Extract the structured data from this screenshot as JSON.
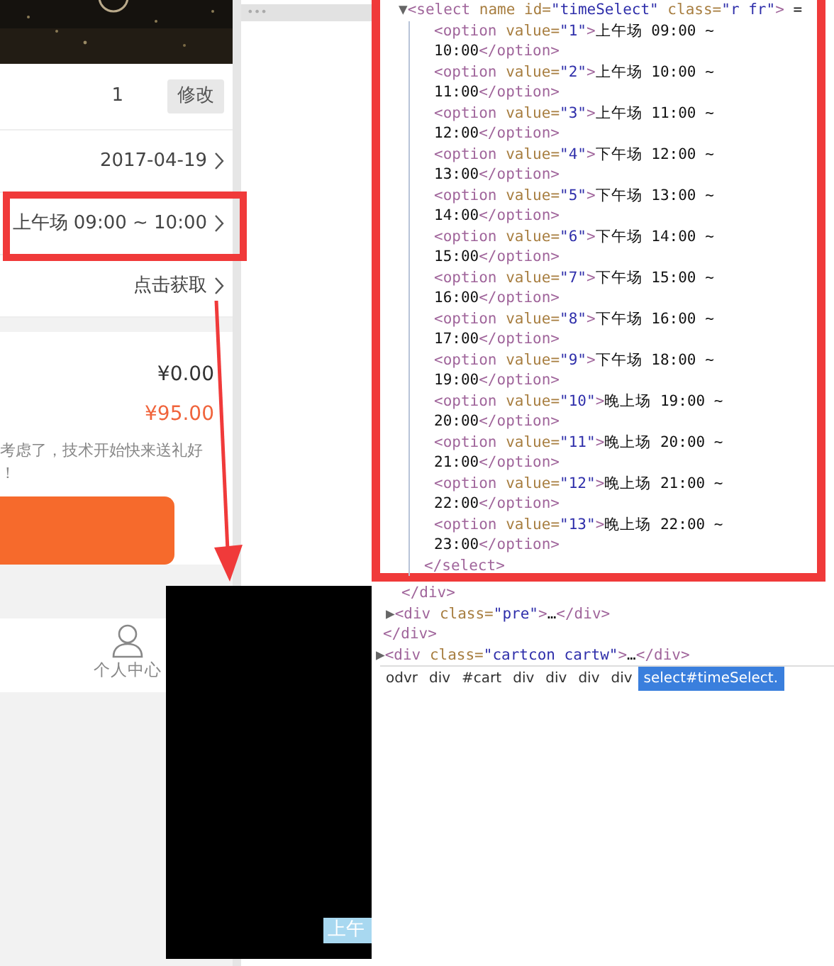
{
  "phone": {
    "rows": [
      {
        "kind": "quantity",
        "value": "1",
        "button": "修改"
      },
      {
        "kind": "select",
        "value": "2017-04-19"
      },
      {
        "kind": "select",
        "value": "上午场 09:00 ~ 10:00"
      },
      {
        "kind": "select",
        "value": "点击获取"
      }
    ],
    "prices": [
      {
        "value": "¥0.00",
        "color": "#333333"
      },
      {
        "value": "¥95.00",
        "color": "#f0643c"
      }
    ],
    "note": [
      "考虑了，技术开始快来送礼好",
      "！"
    ],
    "nav": [
      {
        "label": "个人中心",
        "selected": false
      }
    ]
  },
  "devtools": {
    "menu": "•••",
    "lines": [
      {
        "kind": "select-open",
        "tokens": [
          {
            "kind": "toggle",
            "text": "▼"
          },
          {
            "kind": "tag",
            "text": "<select"
          },
          {
            "kind": "attr",
            "text": " name id="
          },
          {
            "kind": "value",
            "text": "\"timeSelect\""
          },
          {
            "kind": "attr",
            "text": " class="
          },
          {
            "kind": "value",
            "text": "\"r fr\""
          },
          {
            "kind": "tag",
            "text": ">"
          },
          {
            "kind": "text",
            "text": " ="
          }
        ]
      },
      {
        "kind": "option",
        "tokens": [
          {
            "kind": "tag",
            "text": "<option"
          },
          {
            "kind": "attr",
            "text": " value="
          },
          {
            "kind": "value",
            "text": "\"1\""
          },
          {
            "kind": "tag",
            "text": ">"
          },
          {
            "kind": "text",
            "text": "上午场 09:00 ~ 10:00"
          },
          {
            "kind": "tag",
            "text": "</option>"
          }
        ]
      },
      {
        "kind": "option",
        "tokens": [
          {
            "kind": "tag",
            "text": "<option"
          },
          {
            "kind": "attr",
            "text": " value="
          },
          {
            "kind": "value",
            "text": "\"2\""
          },
          {
            "kind": "tag",
            "text": ">"
          },
          {
            "kind": "text",
            "text": "上午场 10:00 ~ 11:00"
          },
          {
            "kind": "tag",
            "text": "</option>"
          }
        ]
      },
      {
        "kind": "option",
        "tokens": [
          {
            "kind": "tag",
            "text": "<option"
          },
          {
            "kind": "attr",
            "text": " value="
          },
          {
            "kind": "value",
            "text": "\"3\""
          },
          {
            "kind": "tag",
            "text": ">"
          },
          {
            "kind": "text",
            "text": "上午场 11:00 ~ 12:00"
          },
          {
            "kind": "tag",
            "text": "</option>"
          }
        ]
      },
      {
        "kind": "option",
        "tokens": [
          {
            "kind": "tag",
            "text": "<option"
          },
          {
            "kind": "attr",
            "text": " value="
          },
          {
            "kind": "value",
            "text": "\"4\""
          },
          {
            "kind": "tag",
            "text": ">"
          },
          {
            "kind": "text",
            "text": "下午场 12:00 ~ 13:00"
          },
          {
            "kind": "tag",
            "text": "</option>"
          }
        ]
      },
      {
        "kind": "option",
        "tokens": [
          {
            "kind": "tag",
            "text": "<option"
          },
          {
            "kind": "attr",
            "text": " value="
          },
          {
            "kind": "value",
            "text": "\"5\""
          },
          {
            "kind": "tag",
            "text": ">"
          },
          {
            "kind": "text",
            "text": "下午场 13:00 ~ 14:00"
          },
          {
            "kind": "tag",
            "text": "</option>"
          }
        ]
      },
      {
        "kind": "option",
        "tokens": [
          {
            "kind": "tag",
            "text": "<option"
          },
          {
            "kind": "attr",
            "text": " value="
          },
          {
            "kind": "value",
            "text": "\"6\""
          },
          {
            "kind": "tag",
            "text": ">"
          },
          {
            "kind": "text",
            "text": "下午场 14:00 ~ 15:00"
          },
          {
            "kind": "tag",
            "text": "</option>"
          }
        ]
      },
      {
        "kind": "option",
        "tokens": [
          {
            "kind": "tag",
            "text": "<option"
          },
          {
            "kind": "attr",
            "text": " value="
          },
          {
            "kind": "value",
            "text": "\"7\""
          },
          {
            "kind": "tag",
            "text": ">"
          },
          {
            "kind": "text",
            "text": "下午场 15:00 ~ 16:00"
          },
          {
            "kind": "tag",
            "text": "</option>"
          }
        ]
      },
      {
        "kind": "option",
        "tokens": [
          {
            "kind": "tag",
            "text": "<option"
          },
          {
            "kind": "attr",
            "text": " value="
          },
          {
            "kind": "value",
            "text": "\"8\""
          },
          {
            "kind": "tag",
            "text": ">"
          },
          {
            "kind": "text",
            "text": "下午场 16:00 ~ 17:00"
          },
          {
            "kind": "tag",
            "text": "</option>"
          }
        ]
      },
      {
        "kind": "option",
        "tokens": [
          {
            "kind": "tag",
            "text": "<option"
          },
          {
            "kind": "attr",
            "text": " value="
          },
          {
            "kind": "value",
            "text": "\"9\""
          },
          {
            "kind": "tag",
            "text": ">"
          },
          {
            "kind": "text",
            "text": "下午场 18:00 ~ 19:00"
          },
          {
            "kind": "tag",
            "text": "</option>"
          }
        ]
      },
      {
        "kind": "option",
        "tokens": [
          {
            "kind": "tag",
            "text": "<option"
          },
          {
            "kind": "attr",
            "text": " value="
          },
          {
            "kind": "value",
            "text": "\"10\""
          },
          {
            "kind": "tag",
            "text": ">"
          },
          {
            "kind": "text",
            "text": "晚上场 19:00 ~ 20:00"
          },
          {
            "kind": "tag",
            "text": "</option>"
          }
        ]
      },
      {
        "kind": "option",
        "tokens": [
          {
            "kind": "tag",
            "text": "<option"
          },
          {
            "kind": "attr",
            "text": " value="
          },
          {
            "kind": "value",
            "text": "\"11\""
          },
          {
            "kind": "tag",
            "text": ">"
          },
          {
            "kind": "text",
            "text": "晚上场 20:00 ~ 21:00"
          },
          {
            "kind": "tag",
            "text": "</option>"
          }
        ]
      },
      {
        "kind": "option",
        "tokens": [
          {
            "kind": "tag",
            "text": "<option"
          },
          {
            "kind": "attr",
            "text": " value="
          },
          {
            "kind": "value",
            "text": "\"12\""
          },
          {
            "kind": "tag",
            "text": ">"
          },
          {
            "kind": "text",
            "text": "晚上场 21:00 ~ 22:00"
          },
          {
            "kind": "tag",
            "text": "</option>"
          }
        ]
      },
      {
        "kind": "option",
        "tokens": [
          {
            "kind": "tag",
            "text": "<option"
          },
          {
            "kind": "attr",
            "text": " value="
          },
          {
            "kind": "value",
            "text": "\"13\""
          },
          {
            "kind": "tag",
            "text": ">"
          },
          {
            "kind": "text",
            "text": "晚上场 22:00 ~ 23:00"
          },
          {
            "kind": "tag",
            "text": "</option>"
          }
        ]
      },
      {
        "kind": "select-close",
        "tokens": [
          {
            "kind": "tag",
            "text": "</select>"
          }
        ]
      },
      {
        "kind": "div-close",
        "tokens": [
          {
            "kind": "tag",
            "text": "</div>"
          }
        ]
      },
      {
        "kind": "div-collapsed",
        "tokens": [
          {
            "kind": "toggle",
            "text": "▶"
          },
          {
            "kind": "tag",
            "text": "<div"
          },
          {
            "kind": "attr",
            "text": " class="
          },
          {
            "kind": "value",
            "text": "\"pre\""
          },
          {
            "kind": "tag",
            "text": ">"
          },
          {
            "kind": "text",
            "text": "…"
          },
          {
            "kind": "tag",
            "text": "</div>"
          }
        ]
      },
      {
        "kind": "div-close-outer",
        "tokens": [
          {
            "kind": "tag",
            "text": "</div>"
          }
        ]
      },
      {
        "kind": "div-collapsed-outer",
        "tokens": [
          {
            "kind": "toggle",
            "text": "▶"
          },
          {
            "kind": "tag",
            "text": "<div"
          },
          {
            "kind": "attr",
            "text": " class="
          },
          {
            "kind": "value",
            "text": "\"cartcon cartw\""
          },
          {
            "kind": "tag",
            "text": ">"
          },
          {
            "kind": "text",
            "text": "…"
          },
          {
            "kind": "tag",
            "text": "</div>"
          }
        ]
      }
    ],
    "breadcrumbs": [
      {
        "label": "odvr",
        "selected": false
      },
      {
        "label": "div",
        "selected": false
      },
      {
        "label": "#cart",
        "selected": false
      },
      {
        "label": "div",
        "selected": false
      },
      {
        "label": "div",
        "selected": false
      },
      {
        "label": "div",
        "selected": false
      },
      {
        "label": "div",
        "selected": false
      },
      {
        "label": "select#timeSelect.",
        "selected": true
      }
    ]
  },
  "dropdown": {
    "options": [
      {
        "label": "上午",
        "selected": true
      }
    ]
  }
}
